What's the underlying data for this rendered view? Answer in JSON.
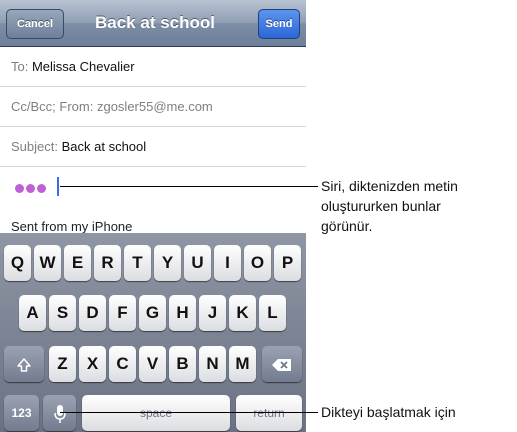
{
  "navbar": {
    "cancel_label": "Cancel",
    "title": "Back at school",
    "send_label": "Send"
  },
  "fields": {
    "to_label": "To:",
    "to_value": "Melissa Chevalier",
    "cc_label": "Cc/Bcc; From:",
    "cc_value": "zgosler55@me.com",
    "subject_label": "Subject:",
    "subject_value": "Back at school"
  },
  "body": {
    "dictation_dot_color": "#c15fd6",
    "cursor_color": "#3a6de0",
    "signature": "Sent from my iPhone"
  },
  "keyboard": {
    "row1": [
      "Q",
      "W",
      "E",
      "R",
      "T",
      "Y",
      "U",
      "I",
      "O",
      "P"
    ],
    "row2": [
      "A",
      "S",
      "D",
      "F",
      "G",
      "H",
      "J",
      "K",
      "L"
    ],
    "row3": [
      "Z",
      "X",
      "C",
      "V",
      "B",
      "N",
      "M"
    ],
    "shift_icon": "shift-arrow-icon",
    "delete_icon": "backspace-icon",
    "numbers_label": "123",
    "mic_icon": "microphone-icon",
    "space_label": "space",
    "return_label": "return"
  },
  "annotations": {
    "siri_note_line1": "Siri, diktenizden metin",
    "siri_note_line2": "oluştururken bunlar",
    "siri_note_line3": "görünür.",
    "mic_note": "Dikteyi başlatmak için"
  }
}
